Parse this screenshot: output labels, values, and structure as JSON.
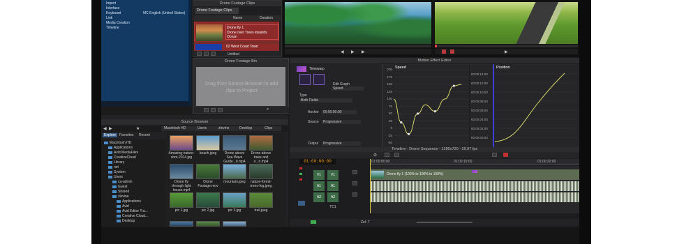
{
  "settings": {
    "rows": [
      {
        "label": "Import",
        "value": ""
      },
      {
        "label": "Interface",
        "value": ""
      },
      {
        "label": "Keyboard",
        "value": "MC English (United States)"
      },
      {
        "label": "Link",
        "value": ""
      },
      {
        "label": "Media Creation",
        "value": ""
      },
      {
        "label": "Timeline",
        "value": ""
      }
    ]
  },
  "bin_panel": {
    "title": "Drone Footage Clips",
    "tab": "Drone Footage Clips",
    "col_name": "Name",
    "col_duration": "Duration",
    "clips": [
      "Drone fly 1",
      "Drone over Trees towards Ocean",
      "02 West Coast Town"
    ],
    "footer": "Untitled"
  },
  "drone_bin": {
    "title": "Drone Footage Bin",
    "drop_hint": "Drag from Source Browser to add clips to Project"
  },
  "source_browser": {
    "title": "Source Browser",
    "tabs": [
      "Explore",
      "Favorites",
      "Recent"
    ],
    "path": [
      "Macintosh HD",
      "Users",
      "zlevine",
      "Desktop",
      "Clips"
    ],
    "tree": [
      "Macintosh HD",
      "Applications",
      "Avid MediaFiles",
      "CreativeCloud",
      "Library",
      "net",
      "System",
      "Users",
      "ca-admin",
      "Guest",
      "Shared",
      "zlevine",
      "Applications",
      "Avid",
      "Avid Editor Tra...",
      "Creative Cloud...",
      "Desktop"
    ],
    "tiles": [
      "Amazing-nature-shot-2014.jpg",
      "beach.jpeg",
      "Drone above Sea Wave Guide...d.mp4",
      "Drone above trees and o...n.mp4",
      "Drone fly through light house.mp4",
      "Drone Footage.mov",
      "mountain.jpeg",
      "nature-forest-trees-fog.jpeg",
      "pic 1.jpg",
      "pic 2.jpg",
      "pic 3.jpg",
      "trail.jpeg"
    ]
  },
  "effect_editor": {
    "title": "Motion Effect Editor",
    "effect_name": "Timewarp",
    "edit_graph_label": "Edit Graph",
    "edit_graph_value": "Speed",
    "type_label": "Type",
    "type_value": "Both Fields",
    "anchor_label": "Anchor",
    "anchor_value": "00:00:00:00",
    "source_label": "Source",
    "source_value": "Progressive",
    "output_label": "Output",
    "output_value": "Progressive",
    "speed_title": "Speed",
    "speed_ticks": [
      "200",
      "175",
      "150",
      "125",
      "100",
      "75",
      "50",
      "25",
      "0",
      "-25",
      "-50"
    ],
    "speed_curve": [
      [
        0,
        100
      ],
      [
        0.1,
        20
      ],
      [
        0.2,
        -20
      ],
      [
        0.32,
        50
      ],
      [
        0.42,
        80
      ],
      [
        0.55,
        58
      ],
      [
        0.68,
        100
      ],
      [
        0.8,
        145
      ],
      [
        0.9,
        150
      ]
    ],
    "position_title": "Position",
    "position_ticks": [
      "00:00:14:00",
      "00:00:12:00",
      "00:00:10:00",
      "00:00:08:00",
      "00:00:06:00",
      "00:00:04:00",
      "00:00:02:00",
      "00:00:00:00"
    ]
  },
  "timeline": {
    "title": "Timeline - Drone Sequence - 1280x720 - 29.97 fps",
    "timecode": "01:00:00:00",
    "ruler": [
      "01:00:00:00",
      "01:00:10:00",
      "01:00:20:00"
    ],
    "tracks": [
      "V1",
      "A1",
      "A2",
      "TC1"
    ],
    "source_tracks": [
      "V1",
      "A1",
      "A2"
    ],
    "clip_label": "Drone fly 1 (100% to 100% to 100%)",
    "zoom_label": "Zel: 7"
  },
  "colors": {
    "accent_red": "#8c2a2a",
    "selection_blue": "#123a63",
    "track_green": "#3e6b47",
    "curve_yellow": "#d7d86b",
    "timecode_orange": "#f0a020"
  }
}
